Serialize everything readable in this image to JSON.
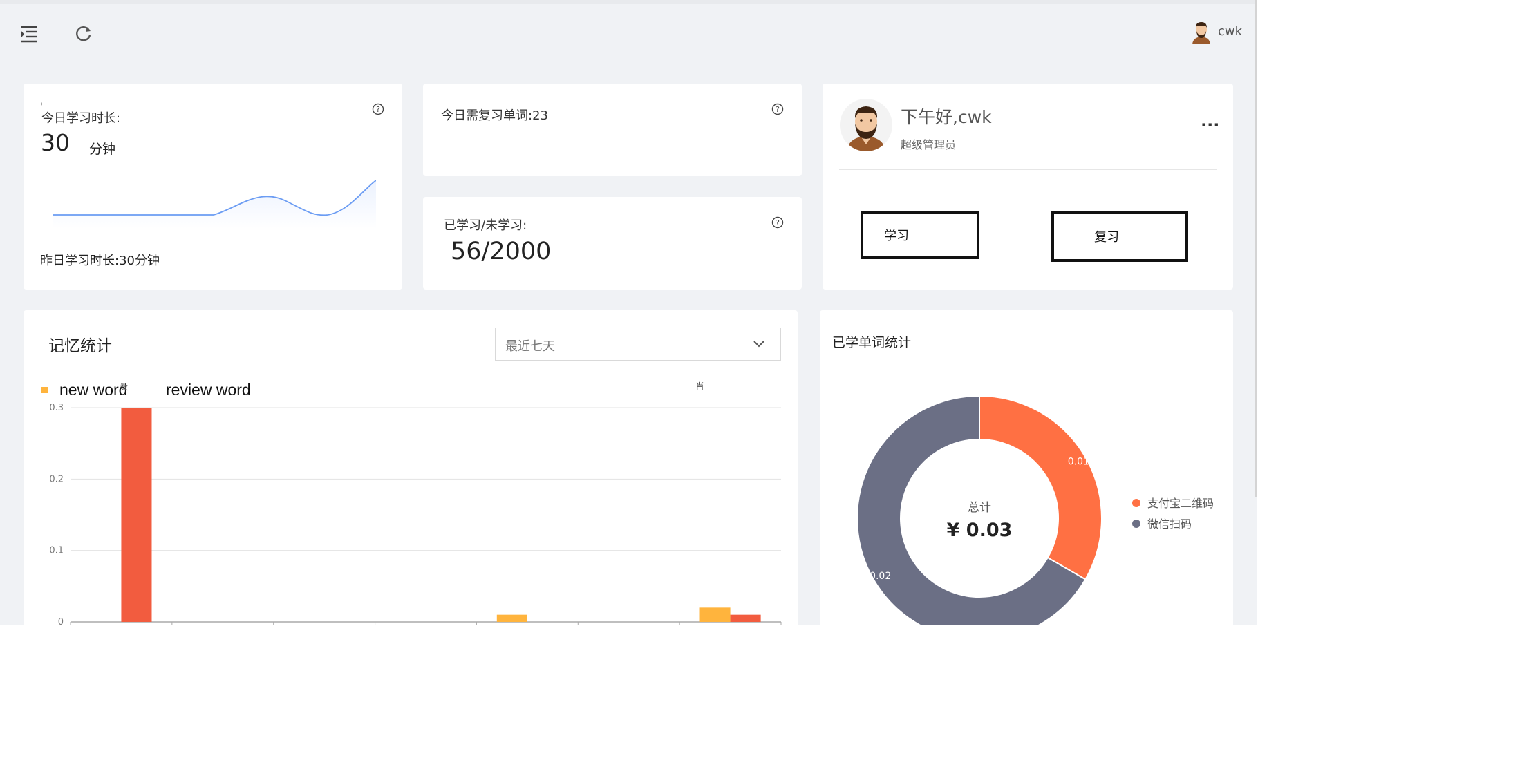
{
  "header": {
    "menu_icon": "indent-menu-icon",
    "refresh_icon": "refresh-icon",
    "user_name": "cwk",
    "avatar_icon": "bearded-man-avatar"
  },
  "study_time": {
    "title": "今日学习时长:",
    "value": "30",
    "unit": "分钟",
    "yesterday": "昨日学习时长:30分钟",
    "mark": "'"
  },
  "review_today": {
    "label": "今日需复习单词:23"
  },
  "learned": {
    "label": "已学习/未学习:",
    "value": "56/2000"
  },
  "profile": {
    "greeting": "下午好,cwk",
    "role": "超级管理员",
    "more": "···",
    "study_button": "学习",
    "review_button": "复习"
  },
  "memory": {
    "title": "记忆统计",
    "range_selected": "最近七天",
    "stray_mark": "肖"
  },
  "learned_stats": {
    "title": "已学单词统计"
  },
  "chart_data": [
    {
      "type": "bar",
      "legend": [
        "new word",
        "review word"
      ],
      "legend_overlap_mark": "数",
      "categories": [
        "",
        "",
        "",
        "",
        "",
        "",
        ""
      ],
      "series": [
        {
          "name": "new word",
          "color": "#ffb43d",
          "values": [
            0,
            0,
            0,
            0,
            0.01,
            0,
            0.02
          ]
        },
        {
          "name": "review word",
          "color": "#f25c3f",
          "values": [
            0.3,
            0,
            0,
            0,
            0,
            0,
            0.01
          ]
        }
      ],
      "y_ticks": [
        "0",
        "0.1",
        "0.2",
        "0.3"
      ],
      "ylim": [
        0,
        0.3
      ],
      "grid": true
    },
    {
      "type": "pie",
      "center_label": "总计",
      "center_value": "¥ 0.03",
      "slices": [
        {
          "name": "支付宝二维码",
          "value": 0.01,
          "label": "0.01",
          "color": "#ff7043"
        },
        {
          "name": "微信扫码",
          "value": 0.02,
          "label": "0.02",
          "color": "#6b6f85"
        }
      ],
      "legend_placement": "right"
    }
  ]
}
